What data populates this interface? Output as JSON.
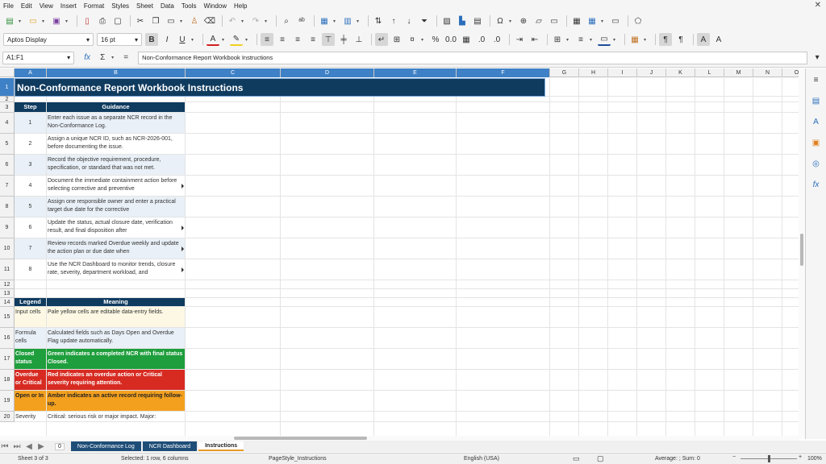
{
  "menu": [
    "File",
    "Edit",
    "View",
    "Insert",
    "Format",
    "Styles",
    "Sheet",
    "Data",
    "Tools",
    "Window",
    "Help"
  ],
  "toolbar": {
    "font_name": "Aptos Display",
    "font_size": "16 pt"
  },
  "formula_bar": {
    "name_box": "A1:F1",
    "formula": "Non-Conformance Report Workbook Instructions"
  },
  "columns": [
    "A",
    "B",
    "C",
    "D",
    "E",
    "F",
    "G",
    "H",
    "I",
    "J",
    "K",
    "L",
    "M",
    "N",
    "O"
  ],
  "rows": [
    "1",
    "2",
    "3",
    "4",
    "5",
    "6",
    "7",
    "8",
    "9",
    "10",
    "11",
    "12",
    "13",
    "14",
    "15",
    "16",
    "17",
    "18",
    "19",
    "20"
  ],
  "sheet": {
    "title": "Non-Conformance Report Workbook Instructions",
    "steps_header": {
      "step": "Step",
      "guidance": "Guidance"
    },
    "steps": [
      {
        "n": "1",
        "text": "Enter each issue as a separate NCR record in the Non-Conformance Log."
      },
      {
        "n": "2",
        "text": "Assign a unique NCR ID, such as NCR-2026-001, before documenting the issue."
      },
      {
        "n": "3",
        "text": "Record the objective requirement, procedure, specification, or standard that was not met."
      },
      {
        "n": "4",
        "text": "Document the immediate containment action before selecting corrective and preventive"
      },
      {
        "n": "5",
        "text": "Assign one responsible owner and enter a practical target due date for the corrective"
      },
      {
        "n": "6",
        "text": "Update the status, actual closure date, verification result, and final disposition after"
      },
      {
        "n": "7",
        "text": "Review records marked Overdue weekly and update the action plan or due date when"
      },
      {
        "n": "8",
        "text": "Use the NCR Dashboard to monitor trends, closure rate, severity, department workload, and"
      }
    ],
    "legend_header": {
      "legend": "Legend",
      "meaning": "Meaning"
    },
    "legend": [
      {
        "label": "Input cells",
        "meaning": "Pale yellow cells are editable data-entry fields.",
        "bg": "#fdf8e4",
        "fg": "#333333",
        "bold": false
      },
      {
        "label": "Formula cells",
        "meaning": "Calculated fields such as Days Open and Overdue Flag update automatically.",
        "bg": "#e9f0f7",
        "fg": "#333333",
        "bold": false
      },
      {
        "label": "Closed status",
        "meaning": "Green indicates a completed NCR with final status Closed.",
        "bg": "#1e9e3c",
        "fg": "#ffffff",
        "bold": true
      },
      {
        "label": "Overdue or Critical",
        "meaning": "Red indicates an overdue action or Critical severity requiring attention.",
        "bg": "#d72b22",
        "fg": "#ffffff",
        "bold": true
      },
      {
        "label": "Open or In",
        "meaning": "Amber indicates an active record requiring follow-up.",
        "bg": "#f3a01f",
        "fg": "#222222",
        "bold": true
      },
      {
        "label": "Severity",
        "meaning": "Critical: serious risk or major impact. Major:",
        "bg": "#ffffff",
        "fg": "#333333",
        "bold": false
      }
    ]
  },
  "tabs": {
    "add": "0",
    "items": [
      "Non-Conformance Log",
      "NCR Dashboard",
      "Instructions"
    ],
    "active": "Instructions"
  },
  "status": {
    "sheet": "Sheet 3 of 3",
    "selection": "Selected: 1 row, 6 columns",
    "page_style": "PageStyle_Instructions",
    "language": "English (USA)",
    "stats": "Average: ; Sum: 0",
    "zoom": "100%"
  },
  "colors": {
    "header_navy": "#0f3b5f",
    "selection_blue": "#3f81c6",
    "tab_active_accent": "#e89b2a"
  }
}
